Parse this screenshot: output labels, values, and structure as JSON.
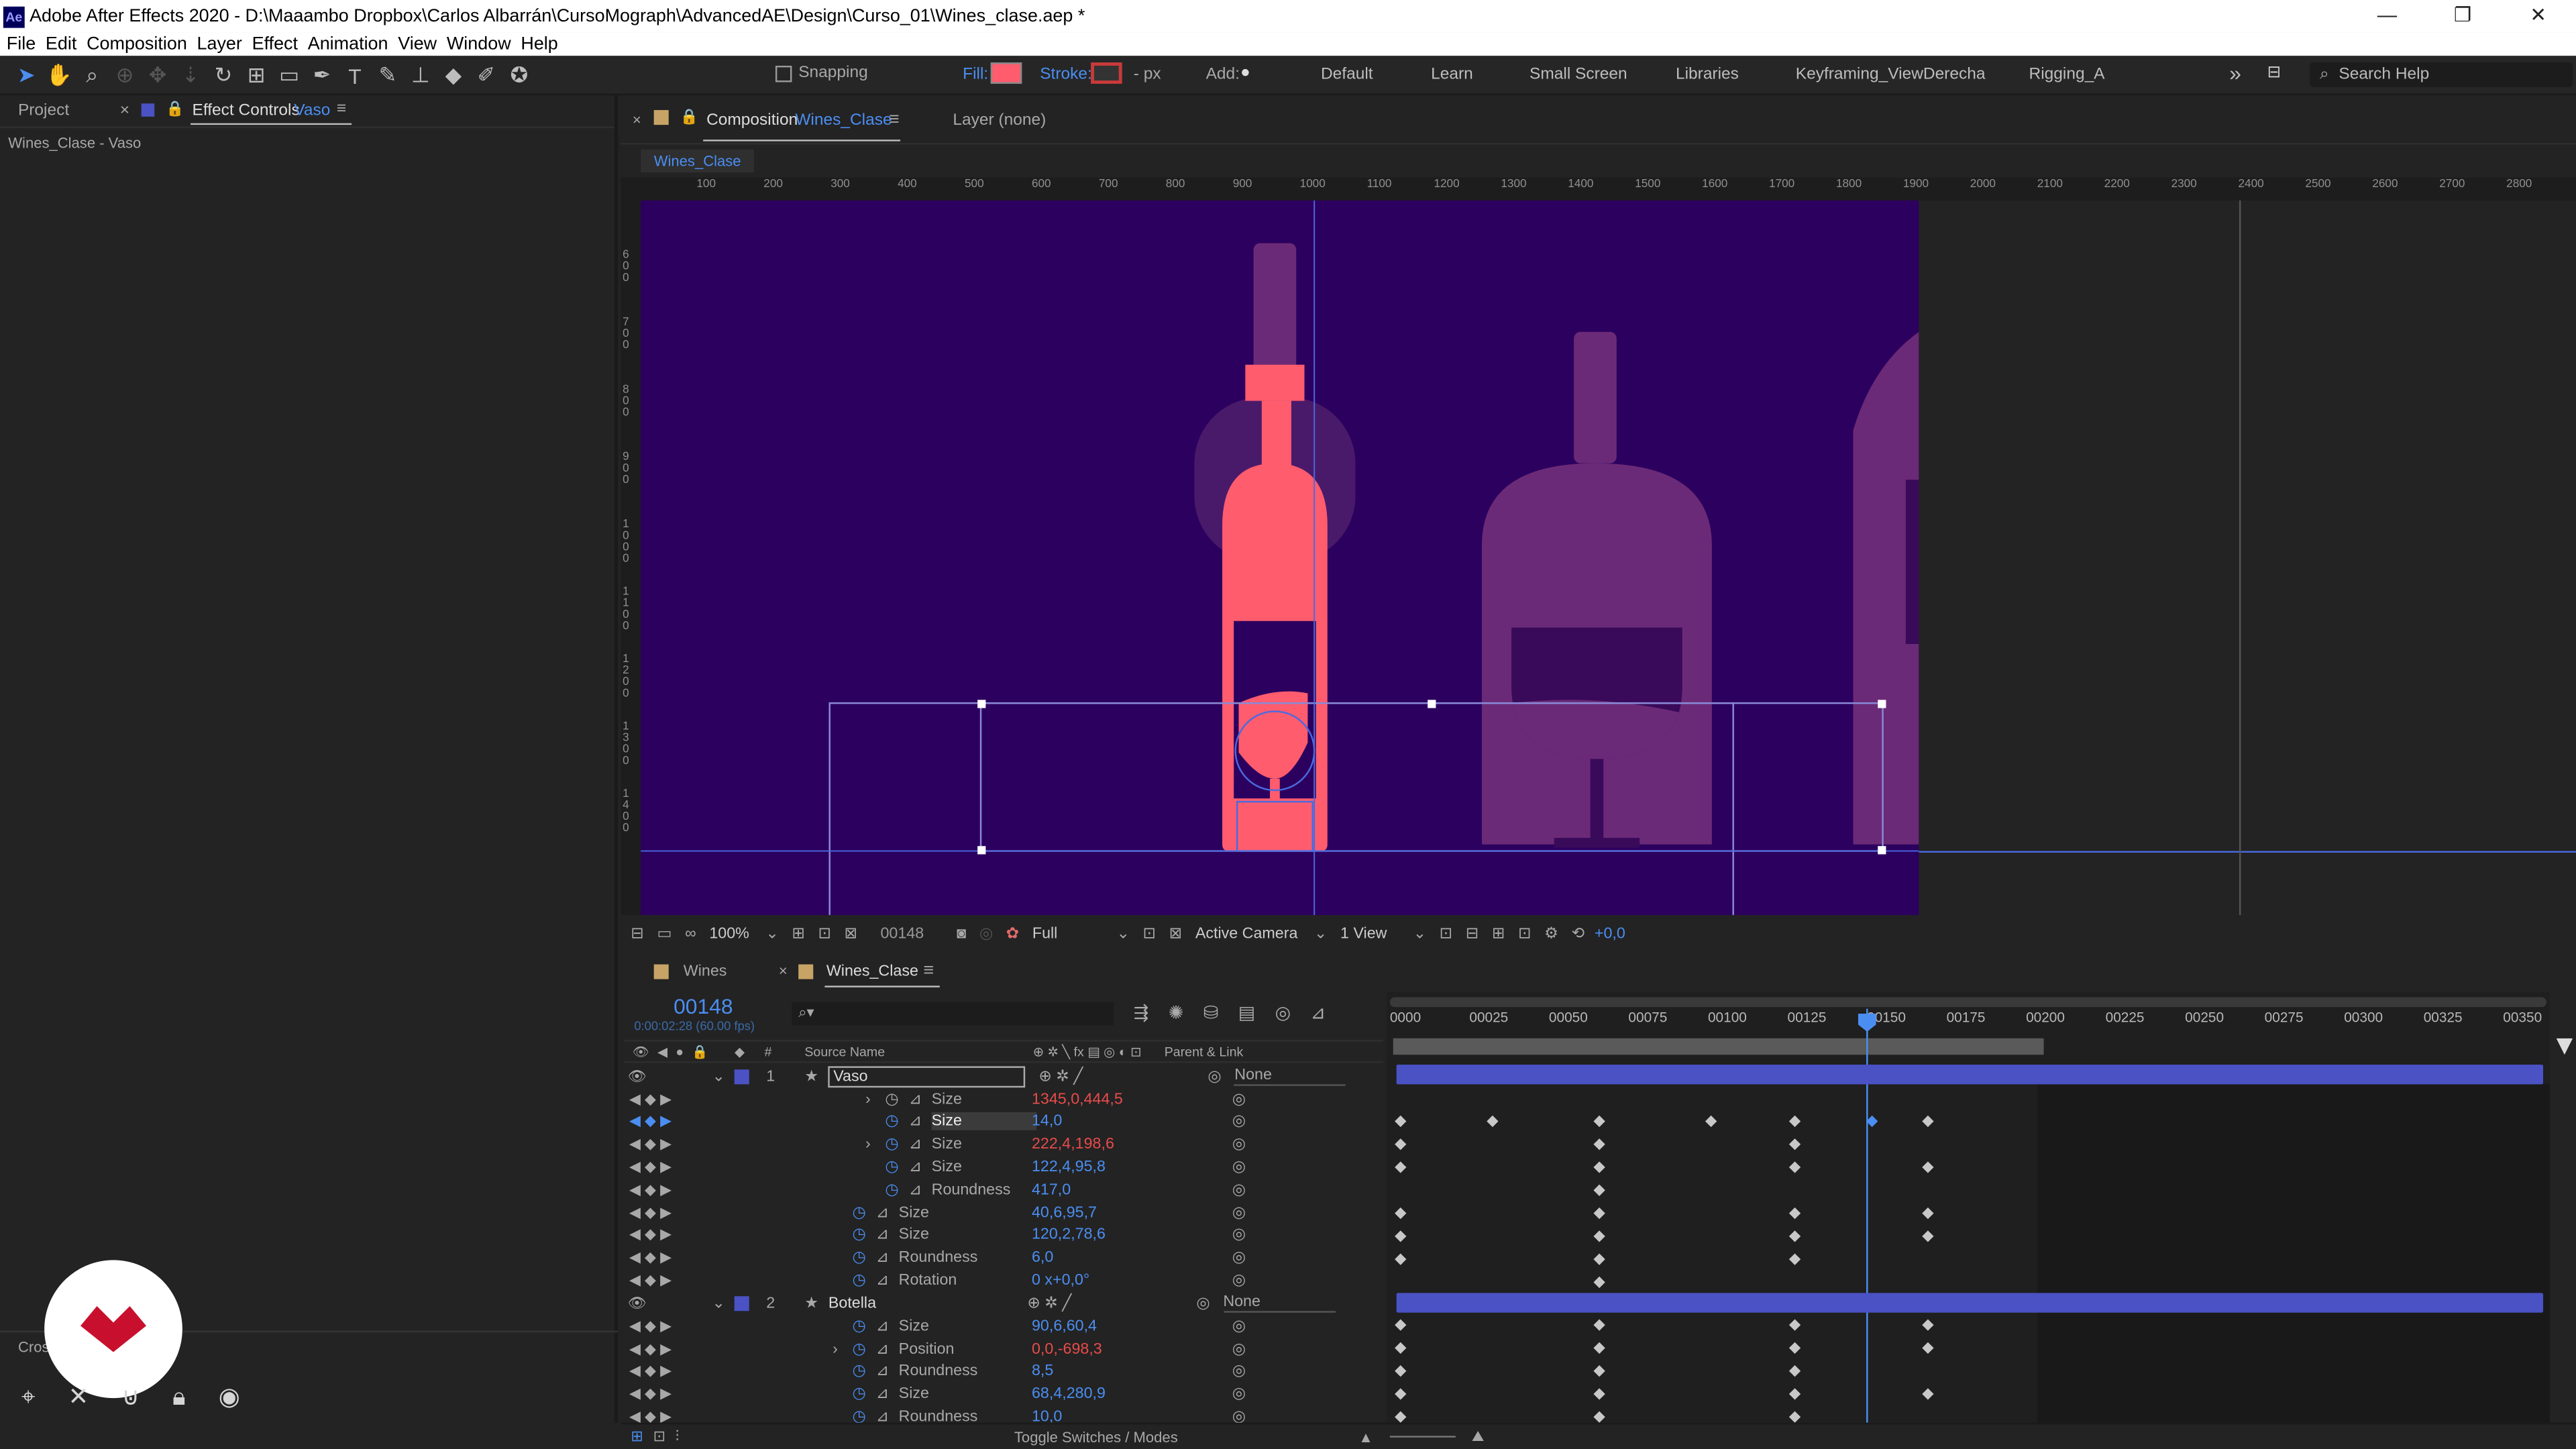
{
  "window": {
    "title": "Adobe After Effects 2020 - D:\\Maaambo Dropbox\\Carlos Albarrán\\CursoMograph\\AdvancedAE\\Design\\Curso_01\\Wines_clase.aep *",
    "app_badge": "Ae",
    "minimize": "—",
    "restore": "❐",
    "close": "✕"
  },
  "menu": [
    "File",
    "Edit",
    "Composition",
    "Layer",
    "Effect",
    "Animation",
    "View",
    "Window",
    "Help"
  ],
  "toolbar": {
    "snapping": "Snapping",
    "fill": "Fill:",
    "stroke": "Stroke:",
    "px": "- px",
    "add": "Add:",
    "workspaces": [
      "Default",
      "Learn",
      "Small Screen",
      "Libraries",
      "Keyframing_ViewDerecha",
      "Rigging_A"
    ],
    "more": "»",
    "search": "Search Help",
    "fill_color": "#ff5c6e",
    "stroke_color": "#c83a3a"
  },
  "left_panel": {
    "tab_project": "Project",
    "tab_effect": "Effect Controls",
    "tab_effect_layer": "Vaso",
    "close": "×",
    "menu": "≡",
    "breadcrumb": "Wines_Clase - Vaso",
    "cross_label": "Cros"
  },
  "comp_panel": {
    "tab_close": "×",
    "tab_label": "Composition",
    "tab_name": "Wines_Clase",
    "menu": "≡",
    "layer_tab": "Layer (none)",
    "flow": "Wines_Clase",
    "ruler_top": [
      "100",
      "200",
      "300",
      "400",
      "500",
      "600",
      "700",
      "800",
      "900",
      "1000",
      "1100",
      "1200",
      "1300",
      "1400",
      "1500",
      "1600",
      "1700",
      "1800",
      "1900",
      "2000",
      "2100",
      "2200",
      "2300",
      "2400",
      "2500",
      "2600",
      "2700",
      "2800"
    ],
    "ruler_left": [
      "6 0 0",
      "7 0 0",
      "8 0 0",
      "9 0 0",
      "1 0 0 0",
      "1 1 0 0",
      "1 2 0 0",
      "1 3 0 0",
      "1 4 0 0"
    ]
  },
  "comp_footer": {
    "zoom": "100%",
    "frame": "00148",
    "resolution": "Full",
    "camera": "Active Camera",
    "view": "1 View",
    "exposure": "+0,0"
  },
  "timeline": {
    "tab1": "Wines",
    "tab2_close": "×",
    "tab2": "Wines_Clase",
    "menu": "≡",
    "timecode": "00148",
    "timecode_sub": "0:00:02:28 (60.00 fps)",
    "search_placeholder": "⌕▾",
    "col_hash": "#",
    "col_source": "Source Name",
    "col_parent": "Parent & Link",
    "ruler": [
      "0000",
      "00025",
      "00050",
      "00075",
      "00100",
      "00125",
      "00150",
      "00175",
      "00200",
      "00225",
      "00250",
      "00275",
      "00300",
      "00325",
      "00350"
    ],
    "toggle": "Toggle Switches / Modes"
  },
  "layers": [
    {
      "num": "1",
      "name": "Vaso",
      "parent": "None",
      "props": [
        {
          "name": "Size",
          "value": "1345,0,444,5",
          "color": "red",
          "twirl": true,
          "plain": true
        },
        {
          "name": "Size",
          "value": "14,0",
          "color": "blue",
          "selected": true
        },
        {
          "name": "Size",
          "value": "222,4,198,6",
          "color": "red",
          "twirl": true
        },
        {
          "name": "Size",
          "value": "122,4,95,8",
          "color": "blue"
        },
        {
          "name": "Roundness",
          "value": "417,0",
          "color": "blue"
        },
        {
          "name": "Size",
          "value": "40,6,95,7",
          "color": "blue"
        },
        {
          "name": "Size",
          "value": "120,2,78,6",
          "color": "blue"
        },
        {
          "name": "Roundness",
          "value": "6,0",
          "color": "blue"
        },
        {
          "name": "Rotation",
          "value": "0 x+0,0°",
          "color": "blue"
        }
      ]
    },
    {
      "num": "2",
      "name": "Botella",
      "parent": "None",
      "props": [
        {
          "name": "Size",
          "value": "90,6,60,4",
          "color": "blue"
        },
        {
          "name": "Position",
          "value": "0,0,-698,3",
          "color": "red",
          "twirl": true
        },
        {
          "name": "Roundness",
          "value": "8,5",
          "color": "blue"
        },
        {
          "name": "Size",
          "value": "68,4,280,9",
          "color": "blue"
        },
        {
          "name": "Roundness",
          "value": "10,0",
          "color": "blue"
        }
      ]
    }
  ],
  "colors": {
    "comp_bg": "#2c005f",
    "bottle": "#ff5c6e",
    "ghost": "#6b2a77",
    "accent": "#4b8ef2",
    "layer_bar": "#4a52c4"
  }
}
